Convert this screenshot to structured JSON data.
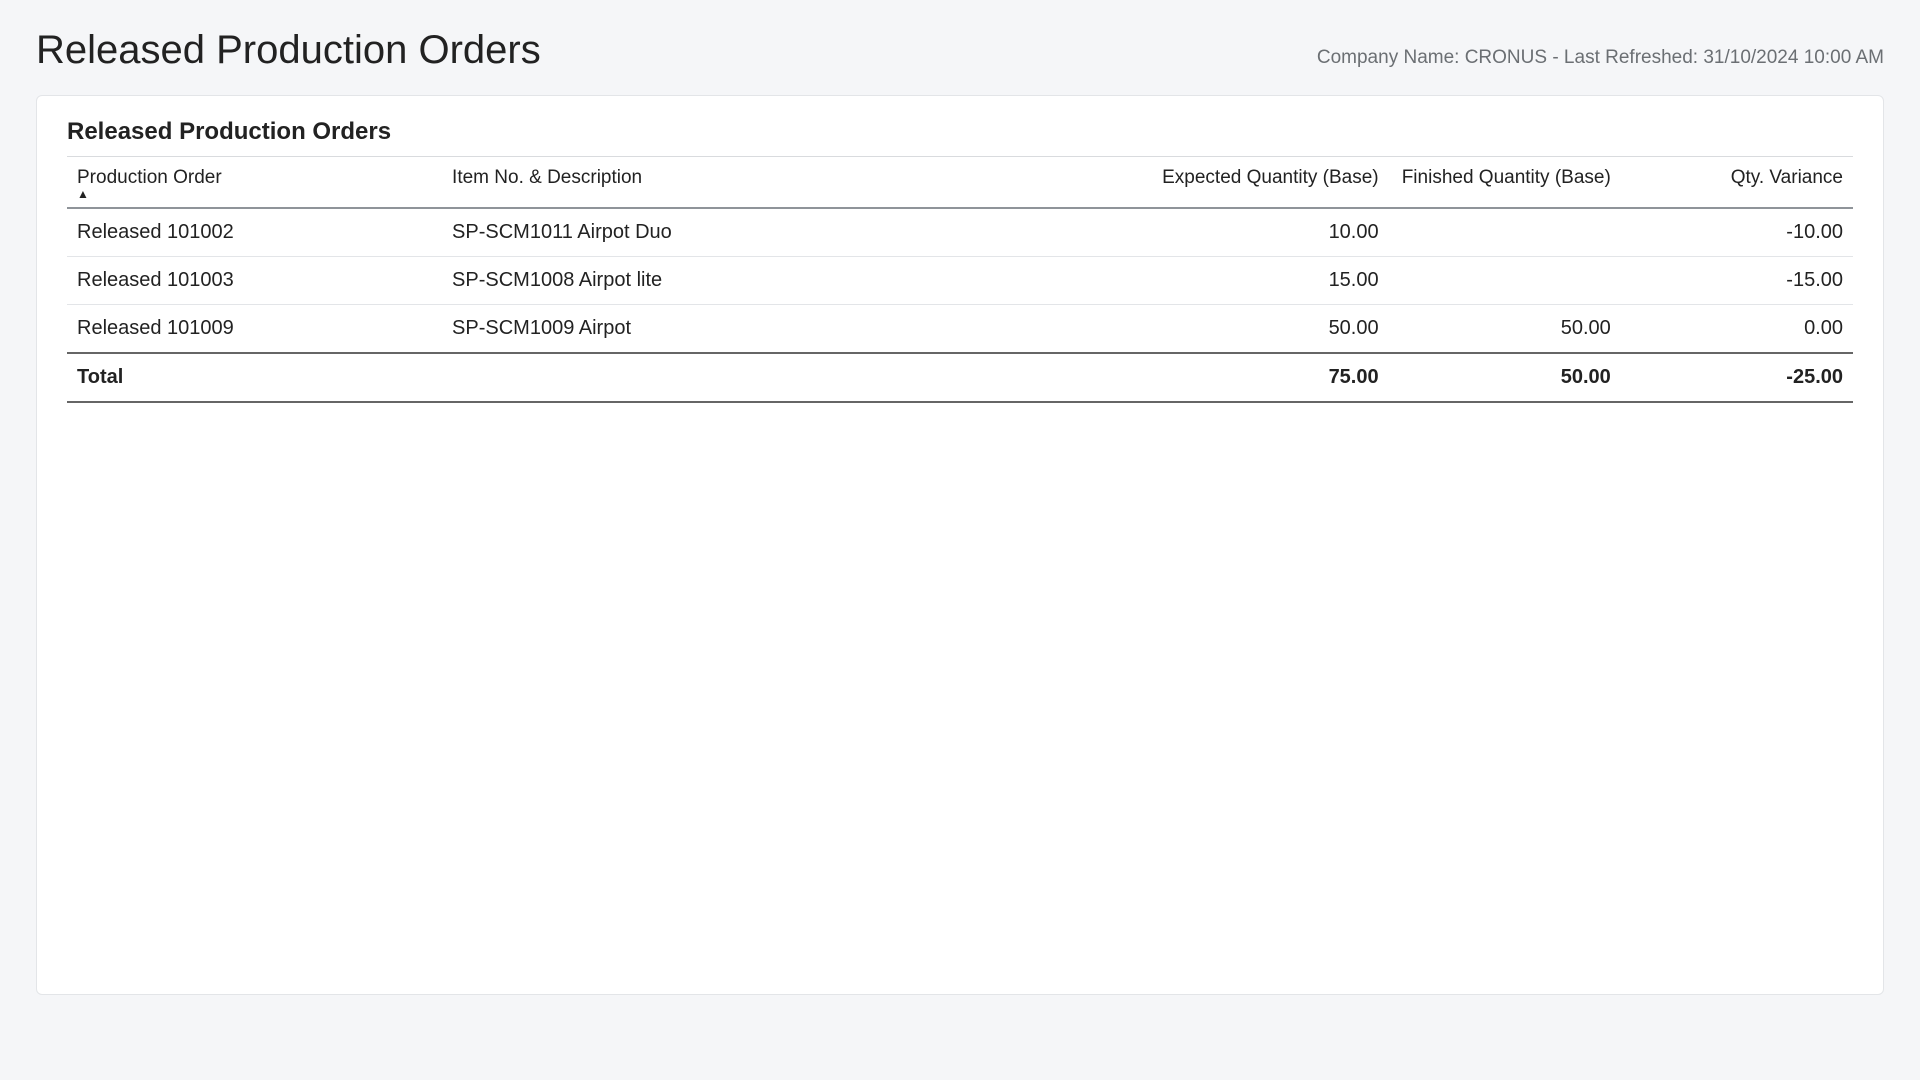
{
  "header": {
    "title": "Released Production Orders",
    "meta": "Company Name: CRONUS - Last Refreshed: 31/10/2024 10:00 AM"
  },
  "card": {
    "subtitle": "Released Production Orders"
  },
  "table": {
    "columns": {
      "order": "Production Order",
      "item": "Item No. & Description",
      "exp": "Expected Quantity (Base)",
      "fin": "Finished Quantity (Base)",
      "var": "Qty. Variance"
    },
    "sort_mark": "▲",
    "rows": [
      {
        "order": "Released 101002",
        "item": "SP-SCM1011 Airpot Duo",
        "exp": "10.00",
        "fin": "",
        "var": "-10.00"
      },
      {
        "order": "Released 101003",
        "item": "SP-SCM1008 Airpot lite",
        "exp": "15.00",
        "fin": "",
        "var": "-15.00"
      },
      {
        "order": "Released 101009",
        "item": "SP-SCM1009 Airpot",
        "exp": "50.00",
        "fin": "50.00",
        "var": "0.00"
      }
    ],
    "total": {
      "label": "Total",
      "exp": "75.00",
      "fin": "50.00",
      "var": "-25.00"
    }
  }
}
